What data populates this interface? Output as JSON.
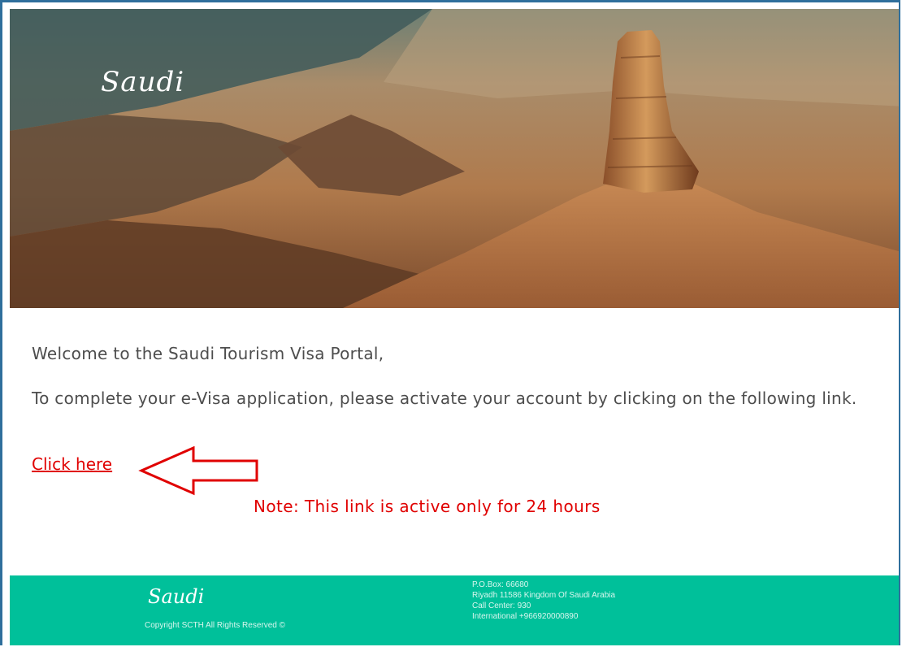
{
  "hero": {
    "logo_text": "Saudi"
  },
  "email": {
    "greeting": "Welcome to the Saudi Tourism Visa Portal,",
    "instruction": "To complete your e-Visa application, please activate your account by clicking on the following link.",
    "link_label": "Click here",
    "note": "Note: This link is active only for 24 hours"
  },
  "footer": {
    "logo_text": "Saudi",
    "copyright": "Copyright SCTH All Rights Reserved ©",
    "address_lines": [
      "P.O.Box: 66680",
      "Riyadh 11586 Kingdom Of Saudi Arabia",
      "Call Center: 930",
      "International +966920000890"
    ]
  },
  "colors": {
    "frame_border": "#2f6f9c",
    "body_text": "#4d4d4d",
    "link_red": "#e00000",
    "footer_bg": "#00c09a"
  }
}
